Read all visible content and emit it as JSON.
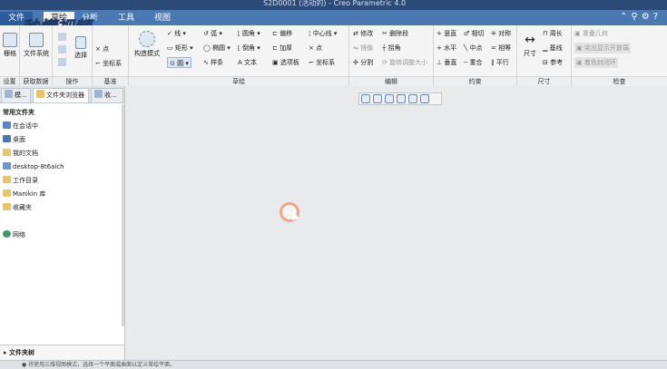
{
  "window": {
    "title": "S2D0001 (活动的) - Creo Parametric 4.0"
  },
  "tabs": [
    {
      "label": "文件"
    },
    {
      "label": "草绘"
    },
    {
      "label": "分析"
    },
    {
      "label": "工具"
    },
    {
      "label": "视图"
    }
  ],
  "watermark": "秒懂视频",
  "ribbon": {
    "settings": {
      "label": "设置",
      "item": "栅格"
    },
    "data": {
      "label": "获取数据",
      "item": "文件系统"
    },
    "ops": {
      "label": "操作",
      "select": "选择"
    },
    "datum": {
      "label": "基准",
      "point": "点",
      "csys": "坐标系"
    },
    "sketch": {
      "label": "草绘",
      "construction": "构造模式",
      "line": "线",
      "arc": "弧",
      "rect": "矩形",
      "ellipse": "椭圆",
      "circle": "圆",
      "spline": "样条",
      "fillet": "圆角",
      "chamfer": "倒角",
      "text": "文本",
      "offset": "偏移",
      "thicken": "加厚",
      "palette": "选项板",
      "centerline": "中心线",
      "point": "点",
      "csys": "坐标系"
    },
    "edit": {
      "label": "编辑",
      "modify": "修改",
      "delete_seg": "删除段",
      "mirror": "镜像",
      "corner": "拐角",
      "divide": "分割",
      "rotate_resize": "旋转调整大小"
    },
    "constrain": {
      "label": "约束",
      "vertical": "竖直",
      "tangent": "相切",
      "symmetric": "对称",
      "horizontal": "水平",
      "midpoint": "中点",
      "equal": "相等",
      "perpendicular": "垂直",
      "coincident": "重合",
      "parallel": "平行"
    },
    "dimension": {
      "label": "尺寸",
      "dim": "尺寸",
      "perimeter": "周长",
      "baseline": "基线",
      "reference": "参考"
    },
    "inspect": {
      "label": "检查",
      "overlap": "重叠几何",
      "highlight_open": "突出显示开放端",
      "shade_closed": "着色封闭环"
    }
  },
  "panel": {
    "tabs": [
      "模...",
      "文件夹浏览器",
      "收..."
    ],
    "heading": "常用文件夹",
    "items": [
      "在会话中",
      "桌面",
      "我的文档",
      "desktop-8t6aich",
      "工作目录",
      "Manikin 库",
      "收藏夹",
      "网络"
    ],
    "footer": "文件夹树"
  },
  "status": "● 将使用三维视图模式，选择一个平面或曲面以定义草绘平面。"
}
